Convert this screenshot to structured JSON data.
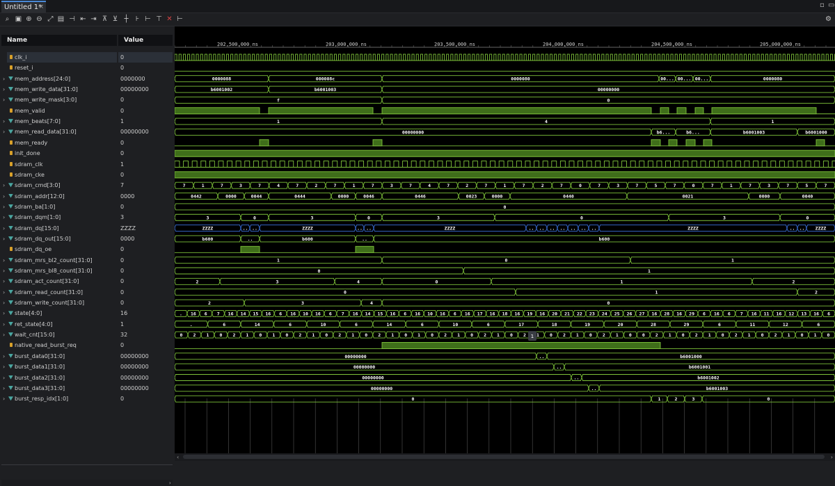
{
  "tab": {
    "title": "Untitled 1*",
    "close": "×"
  },
  "toolbar": {
    "icons": [
      "search-icon",
      "save-icon",
      "zoom-in-icon",
      "zoom-out-icon",
      "zoom-fit-icon",
      "snapshot-icon",
      "add-marker-icon",
      "go-start-icon",
      "go-end-icon",
      "prev-edge-icon",
      "next-edge-icon",
      "prev-marker-icon",
      "next-marker-icon",
      "marker-a-icon",
      "marker-b-icon",
      "marker-c-icon",
      "delete-icon",
      "cursor-icon"
    ]
  },
  "columns": {
    "name": "Name",
    "value": "Value"
  },
  "signals": [
    {
      "name": "clk_i",
      "value": "0",
      "type": "bit",
      "expand": false
    },
    {
      "name": "reset_i",
      "value": "0",
      "type": "bit",
      "expand": false
    },
    {
      "name": "mem_address[24:0]",
      "value": "0000000",
      "type": "bus",
      "expand": true
    },
    {
      "name": "mem_write_data[31:0]",
      "value": "00000000",
      "type": "bus",
      "expand": true
    },
    {
      "name": "mem_write_mask[3:0]",
      "value": "0",
      "type": "bus",
      "expand": true
    },
    {
      "name": "mem_valid",
      "value": "0",
      "type": "bit",
      "expand": false
    },
    {
      "name": "mem_beats[7:0]",
      "value": "1",
      "type": "bus",
      "expand": true
    },
    {
      "name": "mem_read_data[31:0]",
      "value": "00000000",
      "type": "bus",
      "expand": true
    },
    {
      "name": "mem_ready",
      "value": "0",
      "type": "bit",
      "expand": false
    },
    {
      "name": "init_done",
      "value": "0",
      "type": "bit",
      "expand": false
    },
    {
      "name": "sdram_clk",
      "value": "1",
      "type": "bit",
      "expand": false
    },
    {
      "name": "sdram_cke",
      "value": "0",
      "type": "bit",
      "expand": false
    },
    {
      "name": "sdram_cmd[3:0]",
      "value": "7",
      "type": "bus",
      "expand": true
    },
    {
      "name": "sdram_addr[12:0]",
      "value": "0000",
      "type": "bus",
      "expand": true
    },
    {
      "name": "sdram_ba[1:0]",
      "value": "0",
      "type": "bus",
      "expand": true
    },
    {
      "name": "sdram_dqm[1:0]",
      "value": "3",
      "type": "bus",
      "expand": true
    },
    {
      "name": "sdram_dq[15:0]",
      "value": "ZZZZ",
      "type": "bus",
      "expand": true
    },
    {
      "name": "sdram_dq_out[15:0]",
      "value": "0000",
      "type": "bus",
      "expand": true
    },
    {
      "name": "sdram_dq_oe",
      "value": "0",
      "type": "bit",
      "expand": false
    },
    {
      "name": "sdram_mrs_bl2_count[31:0]",
      "value": "0",
      "type": "bus",
      "expand": true
    },
    {
      "name": "sdram_mrs_bl8_count[31:0]",
      "value": "0",
      "type": "bus",
      "expand": true
    },
    {
      "name": "sdram_act_count[31:0]",
      "value": "0",
      "type": "bus",
      "expand": true
    },
    {
      "name": "sdram_read_count[31:0]",
      "value": "0",
      "type": "bus",
      "expand": true
    },
    {
      "name": "sdram_write_count[31:0]",
      "value": "0",
      "type": "bus",
      "expand": true
    },
    {
      "name": "state[4:0]",
      "value": "16",
      "type": "bus",
      "expand": true
    },
    {
      "name": "ret_state[4:0]",
      "value": "1",
      "type": "bus",
      "expand": true
    },
    {
      "name": "wait_cnt[15:0]",
      "value": "32",
      "type": "bus",
      "expand": true
    },
    {
      "name": "native_read_burst_req",
      "value": "0",
      "type": "bit",
      "expand": false
    },
    {
      "name": "burst_data0[31:0]",
      "value": "00000000",
      "type": "bus",
      "expand": true
    },
    {
      "name": "burst_data1[31:0]",
      "value": "00000000",
      "type": "bus",
      "expand": true
    },
    {
      "name": "burst_data2[31:0]",
      "value": "00000000",
      "type": "bus",
      "expand": true
    },
    {
      "name": "burst_data3[31:0]",
      "value": "00000000",
      "type": "bus",
      "expand": true
    },
    {
      "name": "burst_resp_idx[1:0]",
      "value": "0",
      "type": "bus",
      "expand": true
    }
  ],
  "timescale": {
    "labels": [
      "202,500,000 ns",
      "203,000,000 ns",
      "203,500,000 ns",
      "204,000,000 ns",
      "204,500,000 ns",
      "205,000,000 ns"
    ]
  },
  "waves": {
    "mem_address": [
      [
        "0000088",
        0,
        135
      ],
      [
        "000008c",
        135,
        298
      ],
      [
        "0000080",
        298,
        696
      ],
      [
        "00...",
        696,
        720
      ],
      [
        "00...",
        720,
        745
      ],
      [
        "00...",
        745,
        770
      ],
      [
        "0000080",
        770,
        949
      ]
    ],
    "mem_write_data": [
      [
        "b6001002",
        0,
        135
      ],
      [
        "b6001003",
        135,
        298
      ],
      [
        "00000000",
        298,
        949
      ]
    ],
    "mem_write_mask": [
      [
        "f",
        0,
        298
      ],
      [
        "0",
        298,
        949
      ]
    ],
    "mem_beats": [
      [
        "1",
        0,
        298
      ],
      [
        "4",
        298,
        770
      ],
      [
        "1",
        770,
        949
      ]
    ],
    "mem_read_data": [
      [
        "00000000",
        0,
        685
      ],
      [
        "b6...",
        685,
        720
      ],
      [
        "b6...",
        720,
        770
      ],
      [
        "b6001003",
        770,
        895
      ],
      [
        "b6001000",
        895,
        949
      ]
    ],
    "sdram_cmd": [
      "7",
      "1",
      "7",
      "3",
      "7",
      "4",
      "7",
      "2",
      "7",
      "1",
      "7",
      "3",
      "7",
      "4",
      "7",
      "2",
      "7",
      "1",
      "7",
      "2",
      "7",
      "0",
      "7",
      "3",
      "7",
      "5",
      "7",
      "0",
      "7",
      "1",
      "7",
      "3",
      "7",
      "5",
      "7"
    ],
    "sdram_addr": [
      [
        "0442",
        0,
        62
      ],
      [
        "0000",
        62,
        100
      ],
      [
        "0044",
        100,
        135
      ],
      [
        "0444",
        135,
        225
      ],
      [
        "0000",
        225,
        260
      ],
      [
        "0046",
        260,
        298
      ],
      [
        "0446",
        298,
        408
      ],
      [
        "0023",
        408,
        445
      ],
      [
        "0000",
        445,
        482
      ],
      [
        "0440",
        482,
        650
      ],
      [
        "0021",
        650,
        825
      ],
      [
        "0000",
        825,
        870
      ],
      [
        "0040",
        870,
        949
      ]
    ],
    "sdram_ba": [
      [
        "0",
        0,
        949
      ]
    ],
    "sdram_dqm": [
      [
        "3",
        0,
        95
      ],
      [
        "0",
        95,
        135
      ],
      [
        "3",
        135,
        260
      ],
      [
        "0",
        260,
        298
      ],
      [
        "3",
        298,
        460
      ],
      [
        "0",
        460,
        710
      ],
      [
        "3",
        710,
        870
      ],
      [
        "0",
        870,
        949
      ]
    ],
    "sdram_dq": [
      [
        "ZZZZ",
        0,
        95
      ],
      [
        "..",
        95,
        108
      ],
      [
        "..",
        108,
        122
      ],
      [
        "ZZZZ",
        122,
        260
      ],
      [
        "..",
        260,
        272
      ],
      [
        "..",
        272,
        286
      ],
      [
        "ZZZZ",
        286,
        505
      ],
      [
        "..",
        505,
        520
      ],
      [
        "..",
        520,
        535
      ],
      [
        "..",
        535,
        550
      ],
      [
        "..",
        550,
        565
      ],
      [
        "..",
        565,
        580
      ],
      [
        "..",
        580,
        595
      ],
      [
        "..",
        595,
        610
      ],
      [
        "ZZZZ",
        610,
        880
      ],
      [
        "..",
        880,
        895
      ],
      [
        "..",
        895,
        908
      ],
      [
        "ZZZZ",
        908,
        949
      ]
    ],
    "sdram_dq_out": [
      [
        "b600",
        0,
        95
      ],
      [
        "..",
        95,
        122
      ],
      [
        "b600",
        122,
        260
      ],
      [
        "..",
        260,
        286
      ],
      [
        "b600",
        286,
        949
      ]
    ],
    "mrs_bl2": [
      [
        "1",
        0,
        298
      ],
      [
        "0",
        298,
        655
      ],
      [
        "1",
        655,
        949
      ]
    ],
    "mrs_bl8": [
      [
        "0",
        0,
        415
      ],
      [
        "1",
        415,
        949
      ]
    ],
    "act": [
      [
        "2",
        0,
        65
      ],
      [
        "3",
        65,
        230
      ],
      [
        "4",
        230,
        298
      ],
      [
        "0",
        298,
        455
      ],
      [
        "1",
        455,
        830
      ],
      [
        "2",
        830,
        949
      ]
    ],
    "read": [
      [
        "0",
        0,
        490
      ],
      [
        "1",
        490,
        895
      ],
      [
        "2",
        895,
        949
      ]
    ],
    "write": [
      [
        "2",
        0,
        100
      ],
      [
        "3",
        100,
        268
      ],
      [
        "4",
        268,
        298
      ],
      [
        "0",
        298,
        949
      ]
    ],
    "state": [
      ".",
      "16",
      "6",
      "7",
      "16",
      "14",
      "15",
      "16",
      "6",
      "16",
      "10",
      "16",
      "6",
      "7",
      "16",
      "14",
      "15",
      "16",
      "6",
      "16",
      "10",
      "16",
      "6",
      "16",
      "17",
      "16",
      "18",
      "16",
      "19",
      "16",
      "20",
      "21",
      "22",
      "23",
      "24",
      "25",
      "26",
      "27",
      "16",
      "28",
      "16",
      "29",
      "6",
      "16",
      "6",
      "7",
      "16",
      "11",
      "16",
      "12",
      "13",
      "16",
      "6"
    ],
    "ret_state": [
      ".",
      "6",
      "14",
      "6",
      "10",
      "6",
      "14",
      "6",
      "10",
      "6",
      "17",
      "18",
      "19",
      "20",
      "28",
      "29",
      "6",
      "11",
      "12",
      "6"
    ],
    "wait_cnt": [
      "0",
      "2",
      "1",
      "0",
      "2",
      "1",
      "0",
      "1",
      "0",
      "2",
      "1",
      "0",
      "2",
      "1",
      "0",
      "2",
      "1",
      "0",
      "1",
      "0",
      "2",
      "1",
      "0",
      "2",
      "1",
      "0",
      "2",
      "1",
      "0",
      "2",
      "1",
      "0",
      "2",
      "1",
      "0",
      "0",
      "2",
      "1",
      "0",
      "2",
      "1",
      "0",
      "2",
      "1",
      "0",
      "2",
      "1",
      "0",
      "1",
      "0"
    ],
    "burst_data0": [
      [
        "00000000",
        0,
        520
      ],
      [
        "..",
        520,
        535
      ],
      [
        "b6001000",
        535,
        949
      ]
    ],
    "burst_data1": [
      [
        "00000000",
        0,
        545
      ],
      [
        "..",
        545,
        560
      ],
      [
        "b6001001",
        560,
        949
      ]
    ],
    "burst_data2": [
      [
        "00000000",
        0,
        570
      ],
      [
        "..",
        570,
        585
      ],
      [
        "b6001002",
        585,
        949
      ]
    ],
    "burst_data3": [
      [
        "00000000",
        0,
        595
      ],
      [
        "..",
        595,
        610
      ],
      [
        "b6001003",
        610,
        949
      ]
    ],
    "burst_resp_idx": [
      [
        "0",
        0,
        685
      ],
      [
        "1",
        685,
        708
      ],
      [
        "2",
        708,
        733
      ],
      [
        "3",
        733,
        758
      ],
      [
        "0",
        758,
        949
      ]
    ]
  },
  "cursor_label": "1"
}
